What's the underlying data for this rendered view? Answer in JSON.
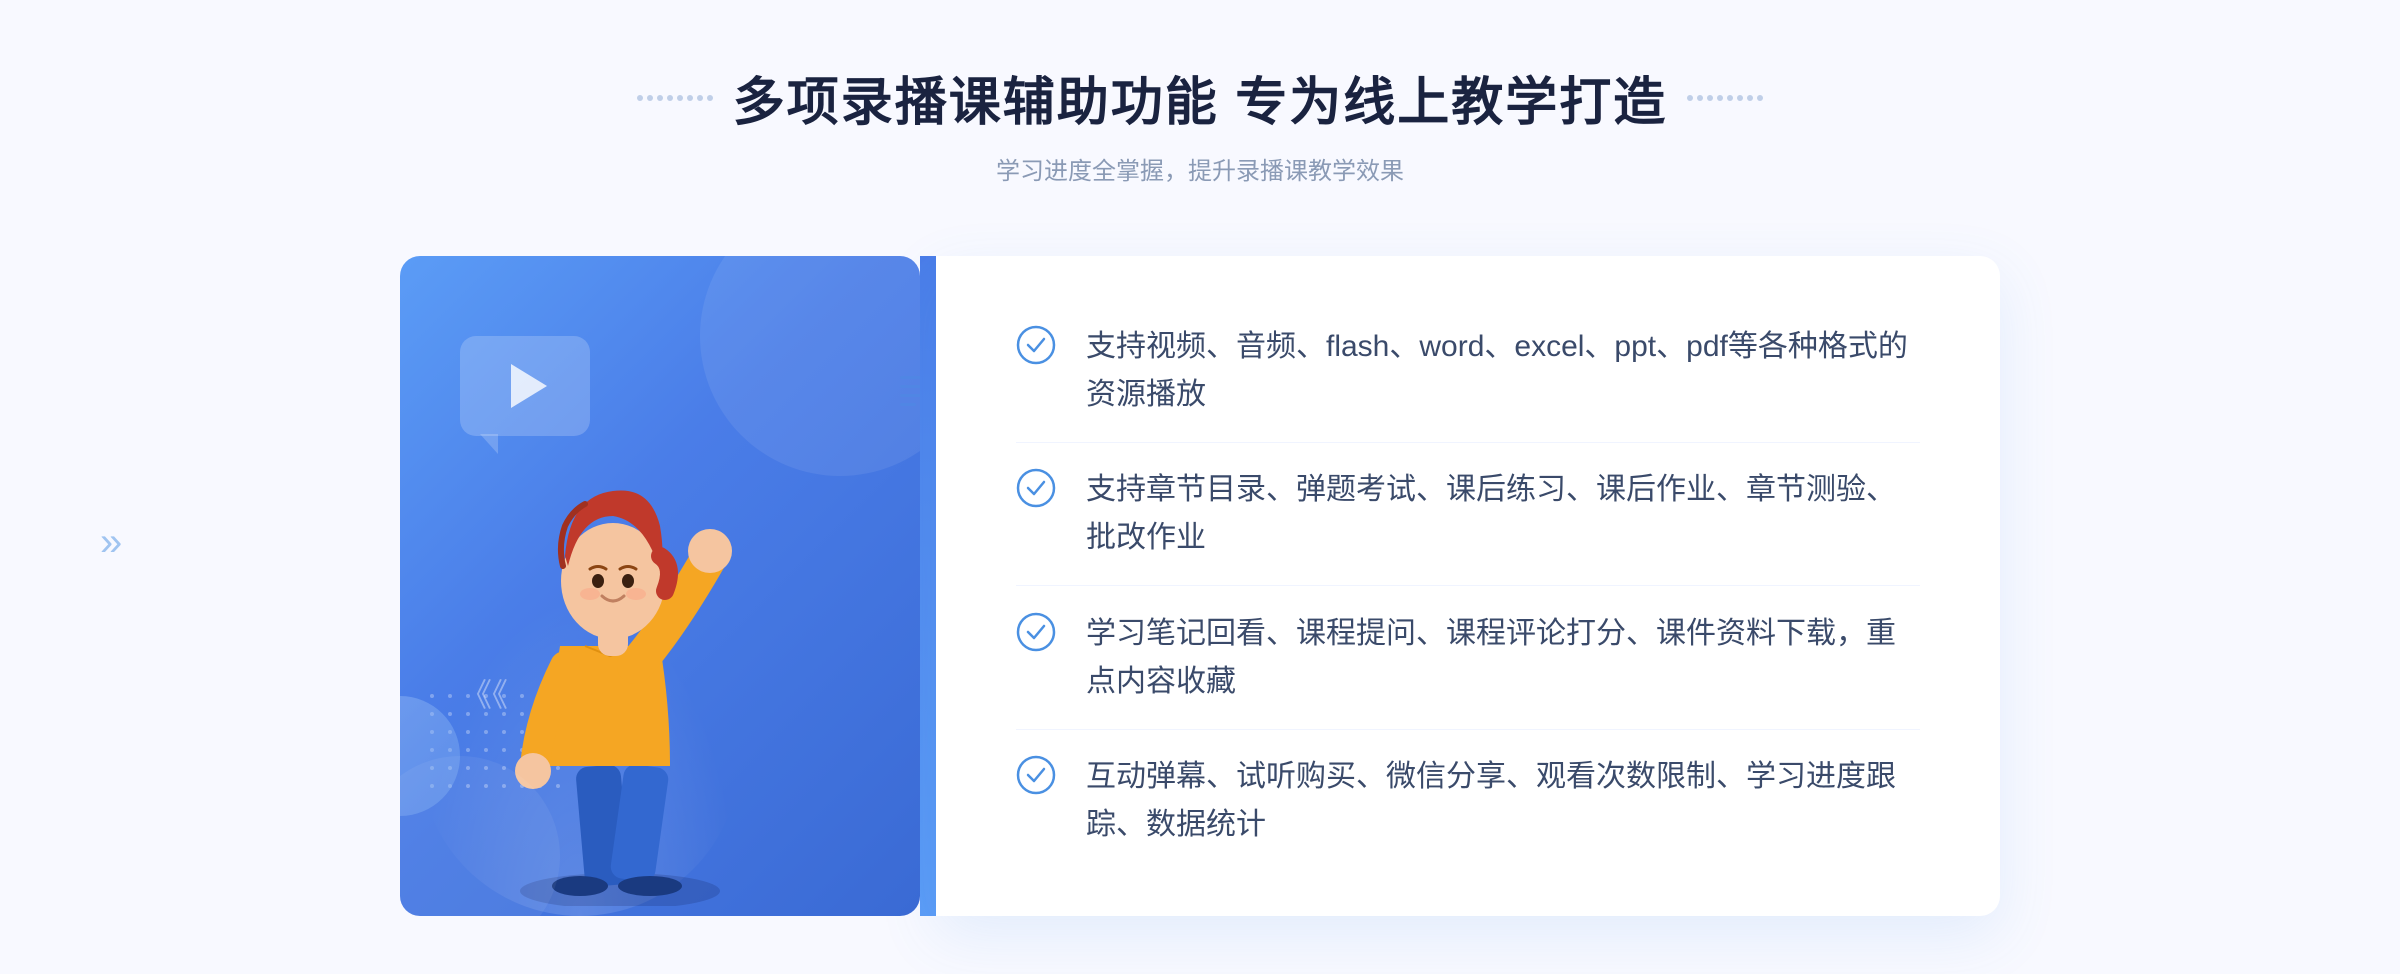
{
  "page": {
    "background_color": "#f5f7ff"
  },
  "header": {
    "main_title": "多项录播课辅助功能 专为线上教学打造",
    "sub_title": "学习进度全掌握，提升录播课教学效果"
  },
  "features": [
    {
      "id": 1,
      "text": "支持视频、音频、flash、word、excel、ppt、pdf等各种格式的资源播放"
    },
    {
      "id": 2,
      "text": "支持章节目录、弹题考试、课后练习、课后作业、章节测验、批改作业"
    },
    {
      "id": 3,
      "text": "学习笔记回看、课程提问、课程评论打分、课件资料下载，重点内容收藏"
    },
    {
      "id": 4,
      "text": "互动弹幕、试听购买、微信分享、观看次数限制、学习进度跟踪、数据统计"
    }
  ],
  "decorators": {
    "left_dots": "❮❮",
    "right_dots": "decorative"
  }
}
